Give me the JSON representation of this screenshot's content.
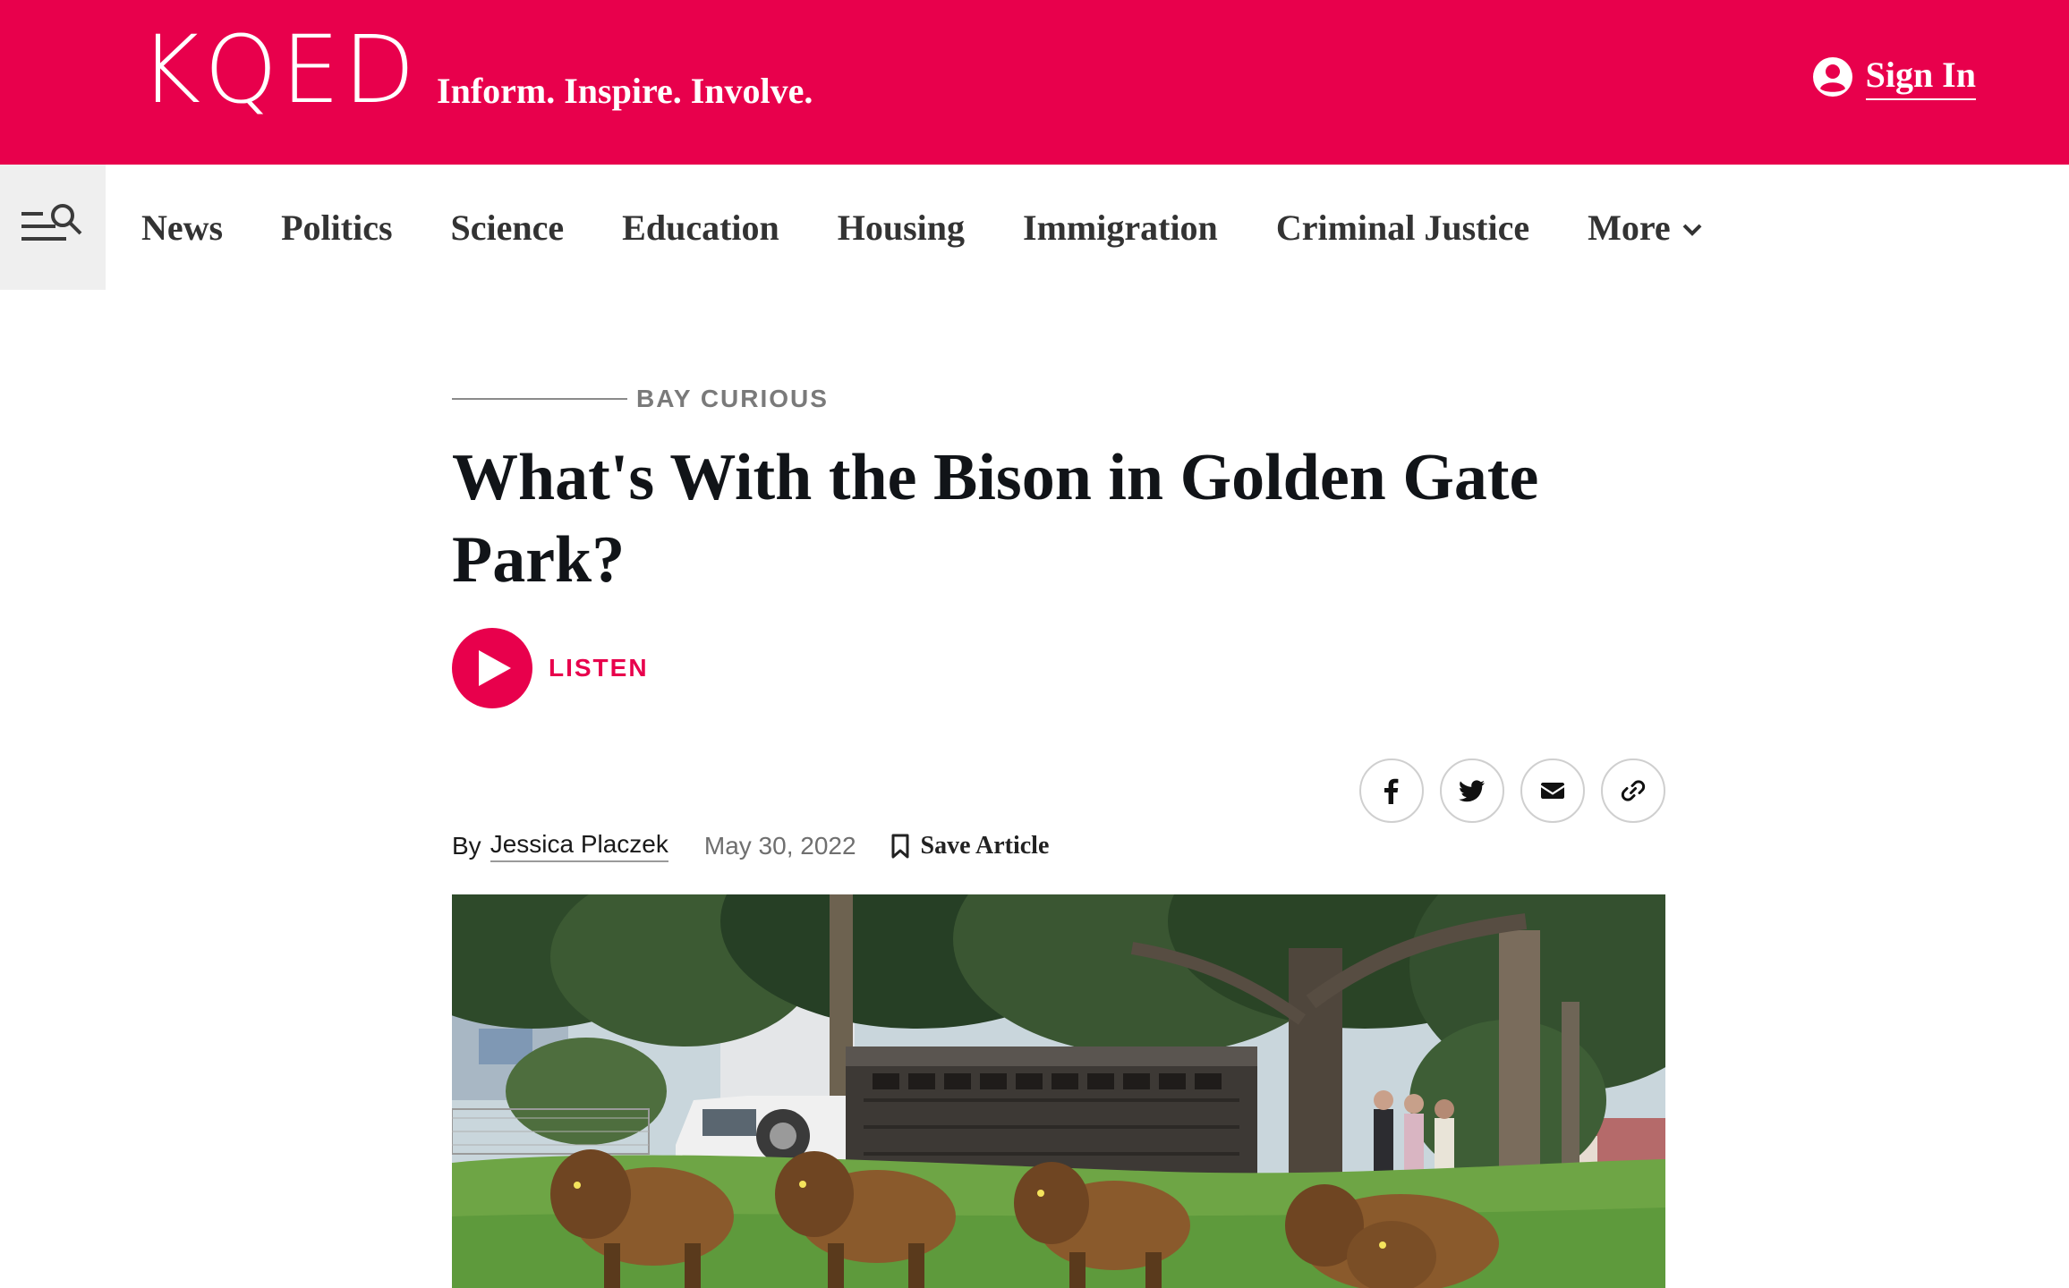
{
  "colors": {
    "brand": "#e8004c",
    "nav_text": "#333333",
    "headline": "#111418",
    "muted": "#7a7a7a"
  },
  "header": {
    "logo": "KQED",
    "tagline": "Inform. Inspire. Involve.",
    "signin_label": "Sign In",
    "signin_icon": "user-circle-icon"
  },
  "nav": {
    "menu_icon": "menu-search-icon",
    "items": [
      {
        "label": "News"
      },
      {
        "label": "Politics"
      },
      {
        "label": "Science"
      },
      {
        "label": "Education"
      },
      {
        "label": "Housing"
      },
      {
        "label": "Immigration"
      },
      {
        "label": "Criminal Justice"
      },
      {
        "label": "More",
        "icon": "chevron-down-icon"
      }
    ]
  },
  "article": {
    "kicker": "BAY CURIOUS",
    "headline": "What's With the Bison in Golden Gate Park?",
    "listen_label": "LISTEN",
    "share_icons": [
      "facebook-icon",
      "twitter-icon",
      "email-icon",
      "link-icon"
    ],
    "byline_prefix": "By",
    "author": "Jessica Placzek",
    "date": "May 30, 2022",
    "save_label": "Save Article",
    "hero_image": "bison-in-park-photo"
  }
}
